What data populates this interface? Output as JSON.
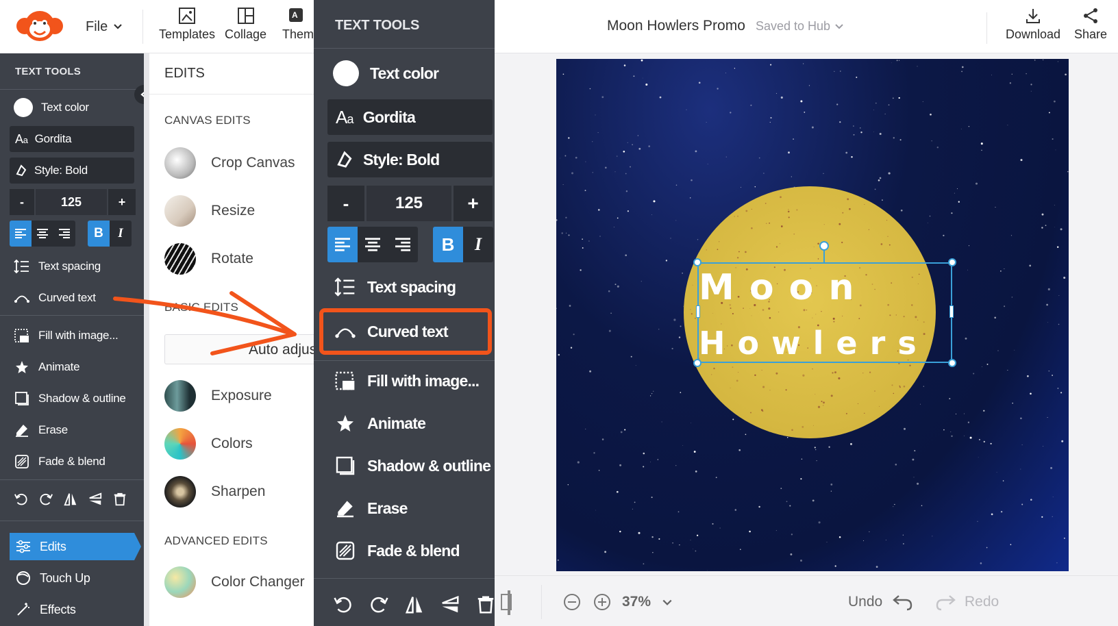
{
  "app": {
    "file_label": "File",
    "templates_label": "Templates",
    "collage_label": "Collage",
    "themes_label": "Themes",
    "doc_title": "Moon Howlers Promo",
    "saved_status": "Saved to Hub",
    "download_label": "Download",
    "share_label": "Share"
  },
  "text_tools": {
    "header": "TEXT TOOLS",
    "text_color": "Text color",
    "font": "Gordita",
    "style": "Style: Bold",
    "size_minus": "-",
    "size_value": "125",
    "size_plus": "+",
    "bold": "B",
    "italic": "I",
    "items": [
      "Text spacing",
      "Curved text",
      "Fill with image...",
      "Animate",
      "Shadow & outline",
      "Erase",
      "Fade & blend"
    ]
  },
  "nav": {
    "edits": "Edits",
    "touch_up": "Touch Up",
    "effects": "Effects"
  },
  "edits_panel": {
    "title": "EDITS",
    "canvas_edits": "CANVAS EDITS",
    "canvas_items": [
      "Crop Canvas",
      "Resize",
      "Rotate"
    ],
    "basic_edits": "BASIC EDITS",
    "auto_adjust": "Auto adjus",
    "basic_items": [
      "Exposure",
      "Colors",
      "Sharpen"
    ],
    "advanced_edits": "ADVANCED EDITS",
    "advanced_items": [
      "Color Changer"
    ]
  },
  "canvas": {
    "line1": "M o o n",
    "line2": "H o w l e r s",
    "moon_color": "#dcbf46",
    "sky_color": "#0c1846"
  },
  "bottom": {
    "zoom": "37%",
    "undo": "Undo",
    "redo": "Redo"
  },
  "colors": {
    "accent_blue": "#2f8ddb",
    "highlight_orange": "#f2541b",
    "panel_dark": "#3d4149"
  }
}
